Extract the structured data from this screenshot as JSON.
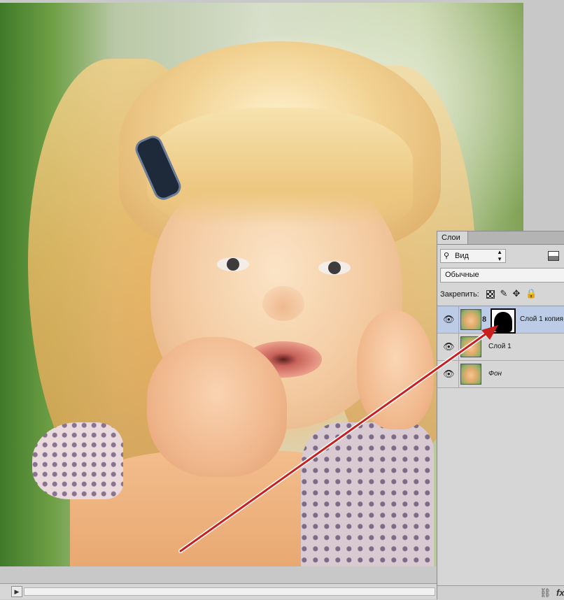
{
  "layers_panel": {
    "tab_label": "Слои",
    "filter": {
      "icon": "search-icon",
      "value": "Вид"
    },
    "blend_mode": "Обычные",
    "lock_label": "Закрепить:",
    "layers": [
      {
        "name": "Слой 1 копия",
        "visible": true,
        "selected": true,
        "has_mask": true
      },
      {
        "name": "Слой 1",
        "visible": true,
        "selected": false,
        "has_mask": false
      },
      {
        "name": "Фон",
        "visible": true,
        "selected": false,
        "has_mask": false
      }
    ]
  },
  "footer": {
    "fx_label": "fx"
  },
  "colors": {
    "arrow": "#c8201e",
    "selected_row": "#bccce6",
    "panel_bg": "#d6d6d6"
  }
}
